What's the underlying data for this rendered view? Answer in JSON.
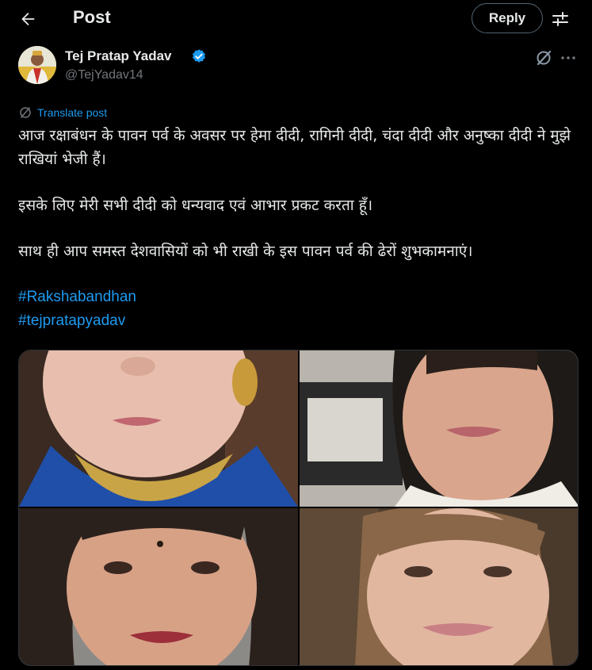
{
  "header": {
    "title": "Post",
    "reply_label": "Reply"
  },
  "author": {
    "name": "Tej Pratap Yadav",
    "handle": "@TejYadav14"
  },
  "translate_label": "Translate post",
  "post": {
    "paragraphs": [
      "आज रक्षाबंधन के पावन पर्व के अवसर पर हेमा दीदी, रागिनी दीदी, चंदा दीदी और अनुष्का दीदी ने मुझे राखियां भेजी हैं।",
      "इसके लिए मेरी सभी दीदी को धन्यवाद एवं आभार प्रकट करता हूँ।",
      "साथ ही आप समस्त देशवासियों को भी राखी के इस पावन पर्व की ढेरों शुभकामनाएं।"
    ],
    "hashtags": [
      "#Rakshabandhan",
      "#tejpratapyadav"
    ]
  },
  "icons": {
    "back": "back-arrow-icon",
    "filter": "sliders-icon",
    "verified": "verified-badge-icon",
    "grok": "grok-icon",
    "more": "more-horizontal-icon",
    "translate": "translate-globe-icon"
  },
  "colors": {
    "background": "#000000",
    "text": "#e7e9ea",
    "secondary": "#71767b",
    "accent": "#1d9bf0",
    "border": "#2f3336"
  }
}
